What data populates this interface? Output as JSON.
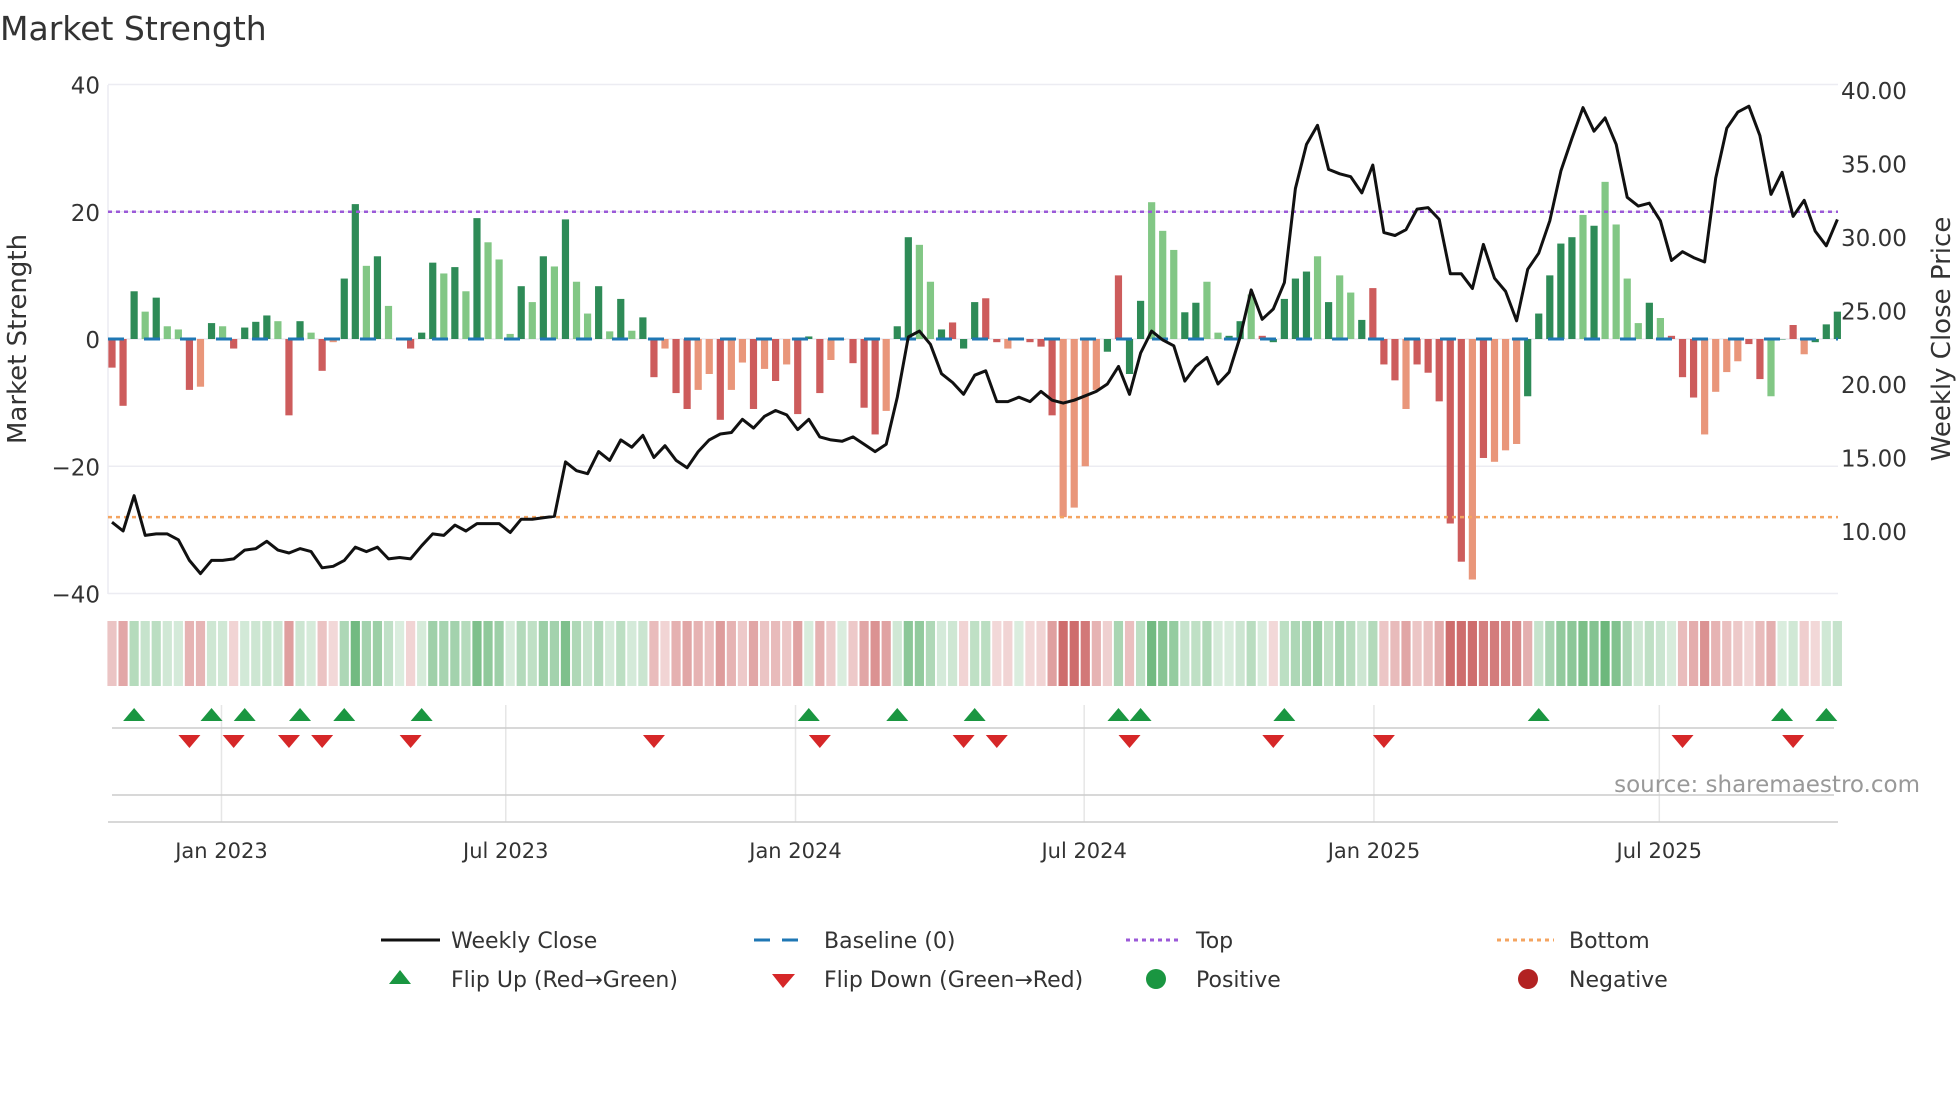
{
  "chart_data": {
    "type": "bar",
    "title": "Market Strength",
    "ylabel": "Market Strength",
    "y2label": "Weekly Close Price",
    "ylim": [
      -40,
      40
    ],
    "y2lim": [
      10,
      40
    ],
    "yticks": [
      {
        "v": 40,
        "label": "40"
      },
      {
        "v": 20,
        "label": "20"
      },
      {
        "v": 0,
        "label": "0"
      },
      {
        "v": -20,
        "label": "−20"
      },
      {
        "v": -40,
        "label": "−40"
      }
    ],
    "y2ticks": [
      {
        "v": 40,
        "label": "40.00"
      },
      {
        "v": 35,
        "label": "35.00"
      },
      {
        "v": 30,
        "label": "30.00"
      },
      {
        "v": 25,
        "label": "25.00"
      },
      {
        "v": 20,
        "label": "20.00"
      },
      {
        "v": 15,
        "label": "15.00"
      },
      {
        "v": 10,
        "label": "10.00"
      }
    ],
    "xticks": [
      {
        "week": 9.9,
        "label": "Jan 2023"
      },
      {
        "week": 35.6,
        "label": "Jul 2023"
      },
      {
        "week": 61.8,
        "label": "Jan 2024"
      },
      {
        "week": 87.9,
        "label": "Jul 2024"
      },
      {
        "week": 114.1,
        "label": "Jan 2025"
      },
      {
        "week": 139.9,
        "label": "Jul 2025"
      }
    ],
    "top_level": 20,
    "bottom_level": -28,
    "strength": [
      -4.5,
      -10.5,
      7.5,
      4.3,
      6.5,
      2,
      1.5,
      -8,
      -7.5,
      2.5,
      2,
      -1.5,
      1.8,
      2.7,
      3.7,
      2.8,
      -12,
      2.8,
      1,
      -5,
      -0.5,
      9.5,
      21.2,
      11.5,
      13,
      5.2,
      0,
      -1.5,
      1,
      12,
      10.3,
      11.3,
      7.5,
      19,
      15.2,
      12.5,
      0.8,
      8.3,
      5.8,
      13,
      11.4,
      18.8,
      9,
      4,
      8.3,
      1.2,
      6.3,
      1.3,
      3.4,
      -6,
      -1.5,
      -8.5,
      -11,
      -8,
      -5.5,
      -12.7,
      -8,
      -3.7,
      -11,
      -4.7,
      -6.6,
      -4,
      -11.8,
      0.4,
      -8.5,
      -3.3,
      0,
      -3.8,
      -10.8,
      -15,
      -11.3,
      2,
      16,
      14.8,
      9,
      1.5,
      2.6,
      -1.5,
      5.8,
      6.4,
      -0.5,
      -1.5,
      0,
      -0.5,
      -1.2,
      -12,
      -28,
      -26.5,
      -20,
      -8,
      -2,
      10,
      -5.5,
      6,
      21.5,
      17,
      14,
      4.2,
      5.7,
      9,
      1,
      0.5,
      2.8,
      7,
      0.5,
      -0.5,
      6.3,
      9.5,
      10.6,
      13,
      5.8,
      10,
      7.3,
      3,
      8,
      -4,
      -6.5,
      -11,
      -4,
      -5.3,
      -9.8,
      -29,
      -35,
      -37.8,
      -18.7,
      -19.3,
      -17.5,
      -16.5,
      -9,
      4,
      10,
      15,
      16,
      19.5,
      17.8,
      24.7,
      18,
      9.5,
      2.5,
      5.7,
      3.3,
      0.5,
      -6,
      -9.2,
      -15,
      -8.3,
      -5.2,
      -3.5,
      -0.8,
      -6.3,
      -9,
      0,
      2.2,
      -2.4,
      -0.5,
      2.3,
      4.3
    ],
    "strength_class": "RRGgGggRrGgRGGGgRGgRrGGgGgg RGGgGgGggg GgGgGggGgGgGRrRRrrRrrRrRrRGRrrRRRrGGggGRGGRRrRRRRrrrrGRGGgggGGggGGgRGGGGgGggGRRRrRRRRRrRrrrGGGGGgGggggGgRRRrrrrRRgGRrGG",
    "price": [
      10.6,
      10.0,
      12.4,
      9.7,
      9.8,
      9.8,
      9.4,
      8.0,
      7.1,
      8.0,
      8.0,
      8.1,
      8.7,
      8.8,
      9.3,
      8.7,
      8.5,
      8.8,
      8.6,
      7.5,
      7.6,
      8.0,
      8.9,
      8.6,
      8.9,
      8.1,
      8.2,
      8.1,
      9.0,
      9.8,
      9.7,
      10.4,
      10.0,
      10.5,
      10.5,
      10.5,
      9.9,
      10.8,
      10.8,
      10.9,
      11.0,
      14.7,
      14.1,
      13.9,
      15.4,
      14.8,
      16.2,
      15.7,
      16.5,
      15.0,
      15.8,
      14.8,
      14.3,
      15.4,
      16.2,
      16.6,
      16.7,
      17.6,
      17.0,
      17.8,
      18.2,
      17.9,
      16.9,
      17.6,
      16.4,
      16.2,
      16.1,
      16.4,
      15.9,
      15.4,
      15.9,
      19.1,
      23.2,
      23.6,
      22.7,
      20.7,
      20.1,
      19.3,
      20.6,
      20.9,
      18.8,
      18.8,
      19.1,
      18.8,
      19.5,
      18.9,
      18.7,
      18.9,
      19.2,
      19.5,
      20.0,
      21.2,
      19.3,
      22.1,
      23.6,
      23.0,
      22.6,
      20.2,
      21.2,
      21.8,
      20.0,
      20.8,
      23.2,
      26.4,
      24.4,
      25.1,
      26.9,
      33.3,
      36.3,
      37.6,
      34.6,
      34.3,
      34.1,
      33.0,
      34.9,
      30.3,
      30.1,
      30.5,
      31.9,
      32.0,
      31.2,
      27.5,
      27.5,
      26.5,
      29.5,
      27.2,
      26.3,
      24.3,
      27.8,
      28.9,
      31.1,
      34.5,
      36.7,
      38.8,
      37.2,
      38.1,
      36.3,
      32.7,
      32.1,
      32.3,
      31.1,
      28.4,
      29.0,
      28.6,
      28.3,
      34.0,
      37.4,
      38.5,
      38.9,
      36.9,
      32.9,
      34.4,
      31.4,
      32.5,
      30.4,
      29.4,
      31.2
    ],
    "flip_up_weeks": [
      2,
      9,
      12,
      17,
      21,
      28,
      63,
      71,
      78,
      91,
      93,
      106,
      129,
      151,
      155
    ],
    "flip_down_weeks": [
      7,
      11,
      16,
      19,
      27,
      49,
      64,
      77,
      80,
      92,
      105,
      115,
      142,
      152
    ],
    "legend": {
      "weekly_close": "Weekly Close",
      "baseline": "Baseline (0)",
      "top": "Top",
      "bottom": "Bottom",
      "flip_up": "Flip Up (Red→Green)",
      "flip_down": "Flip Down (Green→Red)",
      "positive": "Positive",
      "negative": "Negative"
    },
    "legend_position": "bottom",
    "source": "source: sharemaestro.com",
    "colors": {
      "pos_strong": "#2e8b57",
      "pos_weak": "#82c785",
      "neg_strong": "#cd5c5c",
      "neg_weak": "#e9967a",
      "baseline": "#1f77b4",
      "top": "#9b59d8",
      "bottom": "#f4a460",
      "flip_up": "#1a9641",
      "flip_down": "#d62728",
      "positive": "#1a9641",
      "negative": "#b22222",
      "line": "#111111"
    }
  }
}
